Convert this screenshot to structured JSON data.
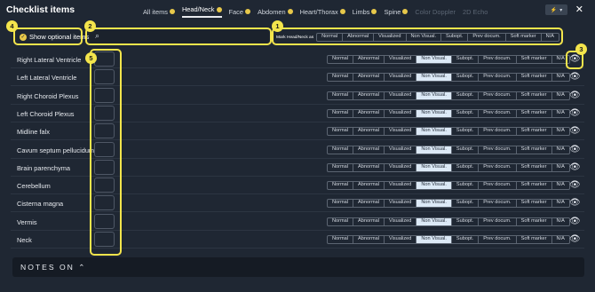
{
  "title": "Checklist items",
  "tabs": [
    {
      "label": "All items",
      "badge": true,
      "active": false,
      "disabled": false
    },
    {
      "label": "Head/Neck",
      "badge": true,
      "active": true,
      "disabled": false
    },
    {
      "label": "Face",
      "badge": true,
      "active": false,
      "disabled": false
    },
    {
      "label": "Abdomen",
      "badge": true,
      "active": false,
      "disabled": false
    },
    {
      "label": "Heart/Thorax",
      "badge": true,
      "active": false,
      "disabled": false
    },
    {
      "label": "Limbs",
      "badge": true,
      "active": false,
      "disabled": false
    },
    {
      "label": "Spine",
      "badge": true,
      "active": false,
      "disabled": false
    },
    {
      "label": "Color Doppler",
      "badge": false,
      "active": false,
      "disabled": true
    },
    {
      "label": "2D Echo",
      "badge": false,
      "active": false,
      "disabled": true
    }
  ],
  "close_glyph": "✕",
  "quick_glyph": "⚡",
  "quick_caret": "▾",
  "optional": {
    "label": "Show optional items",
    "checked": true,
    "check_glyph": "✓"
  },
  "search": {
    "placeholder": "",
    "icon_glyph": "⌕"
  },
  "mark_all": {
    "label": "Mark Head/Neck as"
  },
  "options": [
    "Normal",
    "Abnormal",
    "Visualized",
    "Non Visual.",
    "Subopt.",
    "Prev docum.",
    "Soft marker",
    "N/A"
  ],
  "items": [
    {
      "name": "Right Lateral Ventricle",
      "selected": "Non Visual."
    },
    {
      "name": "Left Lateral Ventricle",
      "selected": "Non Visual."
    },
    {
      "name": "Right Choroid Plexus",
      "selected": "Non Visual."
    },
    {
      "name": "Left Choroid Plexus",
      "selected": "Non Visual."
    },
    {
      "name": "Midline falx",
      "selected": "Non Visual."
    },
    {
      "name": "Cavum septum pellucidum",
      "selected": "Non Visual."
    },
    {
      "name": "Brain parenchyma",
      "selected": "Non Visual."
    },
    {
      "name": "Cerebellum",
      "selected": "Non Visual."
    },
    {
      "name": "Cisterna magna",
      "selected": "Non Visual."
    },
    {
      "name": "Vermis",
      "selected": "Non Visual."
    },
    {
      "name": "Neck",
      "selected": "Non Visual."
    }
  ],
  "eye_glyph": "👁",
  "notes": {
    "label": "NOTES ON",
    "caret": "⌃"
  },
  "annotations": [
    "1",
    "2",
    "3",
    "4",
    "5"
  ],
  "colors": {
    "background": "#1f2733",
    "highlight": "#f4e54c",
    "badge": "#e7c84a",
    "selected_option": "#dce9f6"
  }
}
